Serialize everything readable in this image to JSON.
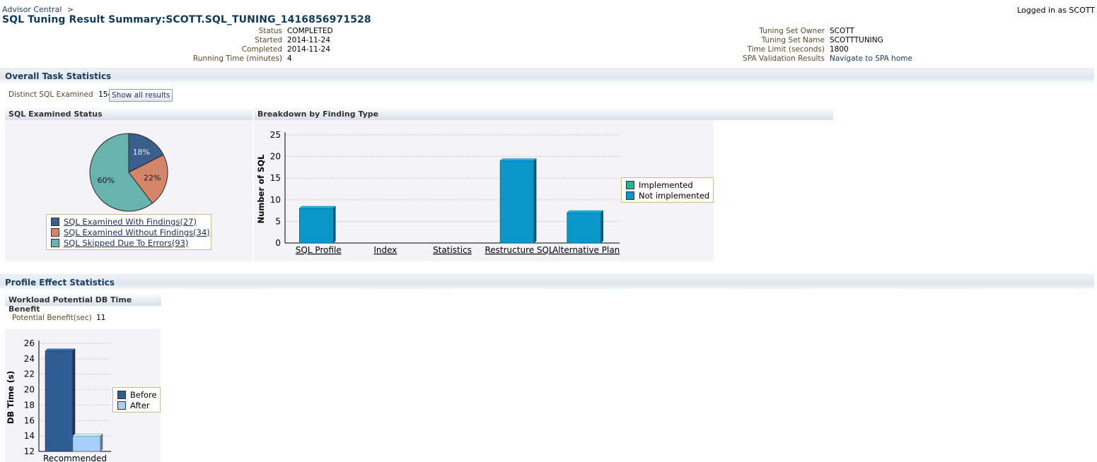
{
  "breadcrumb": {
    "item": "Advisor Central",
    "separator": ">"
  },
  "user": {
    "logged_in": "Logged in as SCOTT"
  },
  "page_title": "SQL Tuning Result Summary:SCOTT.SQL_TUNING_1416856971528",
  "summary_left": [
    {
      "label": "Status",
      "value": "COMPLETED"
    },
    {
      "label": "Started",
      "value": "2014-11-24"
    },
    {
      "label": "Completed",
      "value": "2014-11-24"
    },
    {
      "label": "Running Time (minutes)",
      "value": "4"
    }
  ],
  "summary_right": [
    {
      "label": "Tuning Set Owner",
      "value": "SCOTT"
    },
    {
      "label": "Tuning Set Name",
      "value": "SCOTTTUNING"
    },
    {
      "label": "Time Limit (seconds)",
      "value": "1800"
    },
    {
      "label": "SPA Validation Results",
      "value": "Navigate to SPA home"
    }
  ],
  "overall": {
    "title": "Overall Task Statistics",
    "distinct_label": "Distinct SQL Examined",
    "distinct_value": "154",
    "show_all_button": "Show all results",
    "status_panel_title": "SQL Examined Status",
    "finding_panel_title": "Breakdown by Finding Type"
  },
  "profile": {
    "title": "Profile Effect Statistics",
    "workload_title": "Workload Potential DB Time Benefit",
    "benefit_label": "Potential Benefit(sec)",
    "benefit_value": "11"
  },
  "chart_data": [
    {
      "type": "pie",
      "categories": [
        "SQL Examined With Findings(27)",
        "SQL Examined Without Findings(34)",
        "SQL Skipped Due To Errors(93)"
      ],
      "values": [
        27,
        34,
        93
      ],
      "slice_labels": [
        "18%",
        "22%",
        "60%"
      ],
      "colors": [
        "#3a5f8a",
        "#d4856a",
        "#68b3ae"
      ],
      "legend": "bottom"
    },
    {
      "type": "bar",
      "categories": [
        "SQL Profile",
        "Index",
        "Statistics",
        "Restructure SQL",
        "Alternative Plan"
      ],
      "series": [
        {
          "name": "Implemented",
          "values": [
            0,
            0,
            0,
            0,
            0
          ],
          "color": "#1fb596"
        },
        {
          "name": "Not implemented",
          "values": [
            8,
            0,
            0,
            19,
            7
          ],
          "color": "#0b96c8"
        }
      ],
      "ylabel": "Number of SQL",
      "ylim": [
        0,
        25
      ],
      "yticks": [
        "0",
        "5",
        "10",
        "15",
        "20",
        "25"
      ],
      "grid": true,
      "legend": "right"
    },
    {
      "type": "bar",
      "categories": [
        "Recommended"
      ],
      "series": [
        {
          "name": "Before",
          "values": [
            25
          ],
          "color": "#2f5c93"
        },
        {
          "name": "After",
          "values": [
            14
          ],
          "color": "#a8cff8"
        }
      ],
      "ylabel": "DB Time (s)",
      "ylim": [
        12,
        26
      ],
      "yticks": [
        "12",
        "14",
        "16",
        "18",
        "20",
        "22",
        "24",
        "26"
      ],
      "grid": true,
      "legend": "right"
    }
  ]
}
